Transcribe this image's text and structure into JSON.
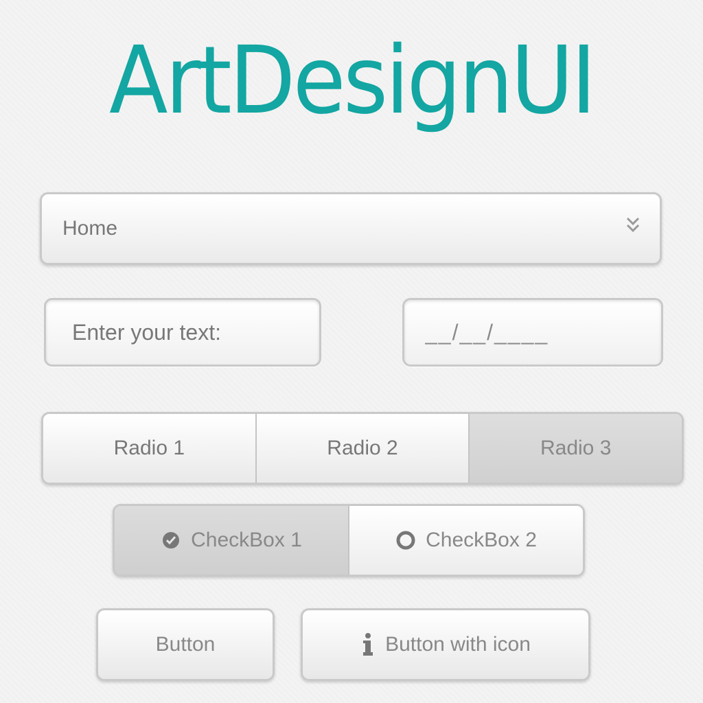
{
  "logo": {
    "text": "ArtDesignUI",
    "color": "#13a6a2"
  },
  "dropdown": {
    "selected": "Home",
    "icon": "chevron-double-down-icon"
  },
  "text_input": {
    "placeholder": "Enter your text:"
  },
  "date_input": {
    "placeholder": "__/__/____"
  },
  "radio_group": {
    "options": [
      "Radio 1",
      "Radio 2",
      "Radio 3"
    ],
    "selected": "Radio 3"
  },
  "checkbox_group": {
    "items": [
      {
        "label": "CheckBox 1",
        "checked": true,
        "icon": "check-circle-icon"
      },
      {
        "label": "CheckBox 2",
        "checked": false,
        "icon": "empty-circle-icon"
      }
    ]
  },
  "buttons": {
    "plain_label": "Button",
    "icon_label": "Button with icon",
    "icon": "info-icon"
  }
}
